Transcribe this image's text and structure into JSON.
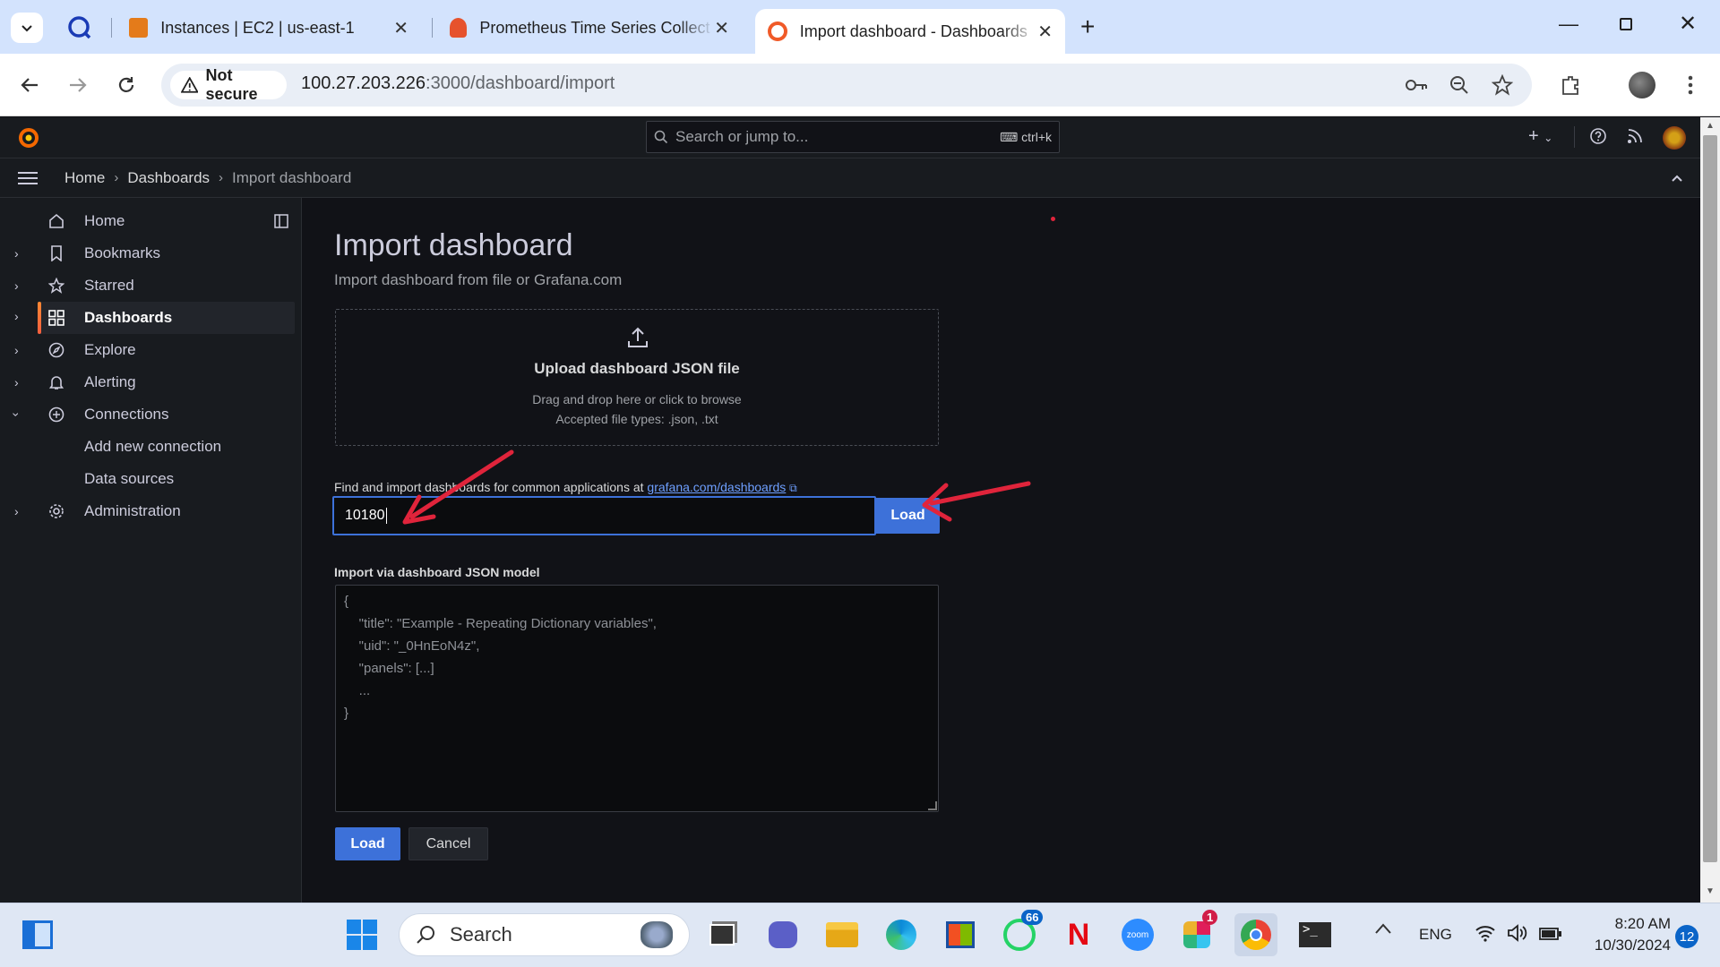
{
  "browser": {
    "tabs": [
      {
        "title": "Instances | EC2 | us-east-1"
      },
      {
        "title": "Prometheus Time Series Collect"
      },
      {
        "title": "Import dashboard - Dashboards"
      }
    ],
    "security_label": "Not secure",
    "url_host": "100.27.203.226",
    "url_path": ":3000/dashboard/import"
  },
  "grafana": {
    "search_placeholder": "Search or jump to...",
    "search_shortcut": "ctrl+k",
    "breadcrumb": [
      "Home",
      "Dashboards",
      "Import dashboard"
    ],
    "sidebar": [
      {
        "label": "Home",
        "icon": "home-icon"
      },
      {
        "label": "Bookmarks",
        "icon": "bookmark-icon"
      },
      {
        "label": "Starred",
        "icon": "star-icon"
      },
      {
        "label": "Dashboards",
        "icon": "grid-icon"
      },
      {
        "label": "Explore",
        "icon": "compass-icon"
      },
      {
        "label": "Alerting",
        "icon": "bell-icon"
      },
      {
        "label": "Connections",
        "icon": "connections-icon"
      },
      {
        "label": "Add new connection"
      },
      {
        "label": "Data sources"
      },
      {
        "label": "Administration",
        "icon": "gear-icon"
      }
    ],
    "page": {
      "title": "Import dashboard",
      "subtitle": "Import dashboard from file or Grafana.com",
      "upload_title": "Upload dashboard JSON file",
      "upload_hint": "Drag and drop here or click to browse",
      "upload_types": "Accepted file types: .json, .txt",
      "find_label": "Find and import dashboards for common applications at",
      "find_link": "grafana.com/dashboards",
      "dashboard_id_value": "10180",
      "load_label": "Load",
      "json_label": "Import via dashboard JSON model",
      "json_placeholder": "{\n    \"title\": \"Example - Repeating Dictionary variables\",\n    \"uid\": \"_0HnEoN4z\",\n    \"panels\": [...]\n    ...\n}",
      "load_button": "Load",
      "cancel_button": "Cancel"
    }
  },
  "taskbar": {
    "search_label": "Search",
    "whatsapp_badge": "66",
    "slack_badge": "1",
    "language": "ENG",
    "time": "8:20 AM",
    "date": "10/30/2024",
    "notifications": "12"
  },
  "colors": {
    "accent": "#3d71d9",
    "annotation_arrow": "#e0243b",
    "grafana_orange": "#f55f3e"
  }
}
